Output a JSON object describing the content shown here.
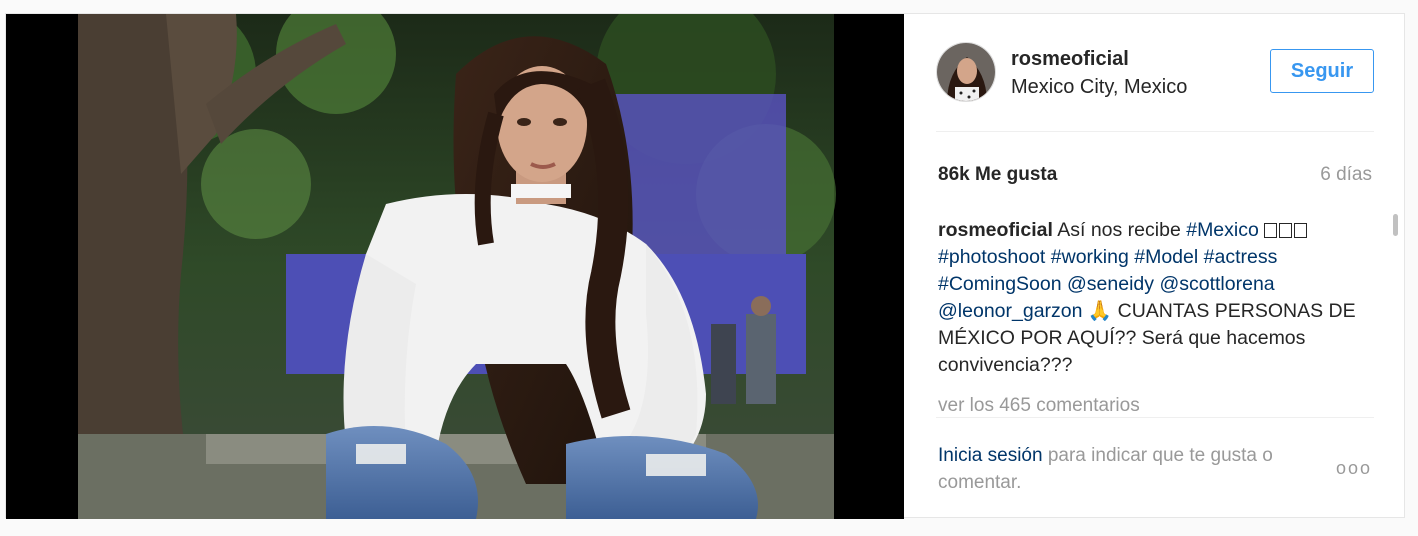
{
  "post": {
    "username": "rosmeoficial",
    "location": "Mexico City, Mexico",
    "follow_label": "Seguir",
    "likes": "86k Me gusta",
    "time": "6 días"
  },
  "caption": {
    "username": "rosmeoficial",
    "text1": "Así nos recibe",
    "tag_mexico": "#Mexico",
    "tag_photoshoot": "#photoshoot",
    "tag_working": "#working",
    "tag_model": "#Model",
    "tag_actress": "#actress",
    "tag_comingsoon": "#ComingSoon",
    "mention_seneidy": "@seneidy",
    "mention_scottlorena": "@scottlorena",
    "mention_leonor": "@leonor_garzon",
    "pray_emoji": "🙏",
    "text2": "CUANTAS PERSONAS DE MÉXICO POR AQUÍ?? Será que hacemos convivencia???"
  },
  "comments": {
    "view_all": "ver los 465 comentarios"
  },
  "footer": {
    "login_link": "Inicia sesión",
    "login_rest": "para indicar que te gusta o comentar.",
    "more_dots": "ooo"
  },
  "colors": {
    "accent": "#3897f0",
    "link": "#003569",
    "muted": "#999999"
  }
}
